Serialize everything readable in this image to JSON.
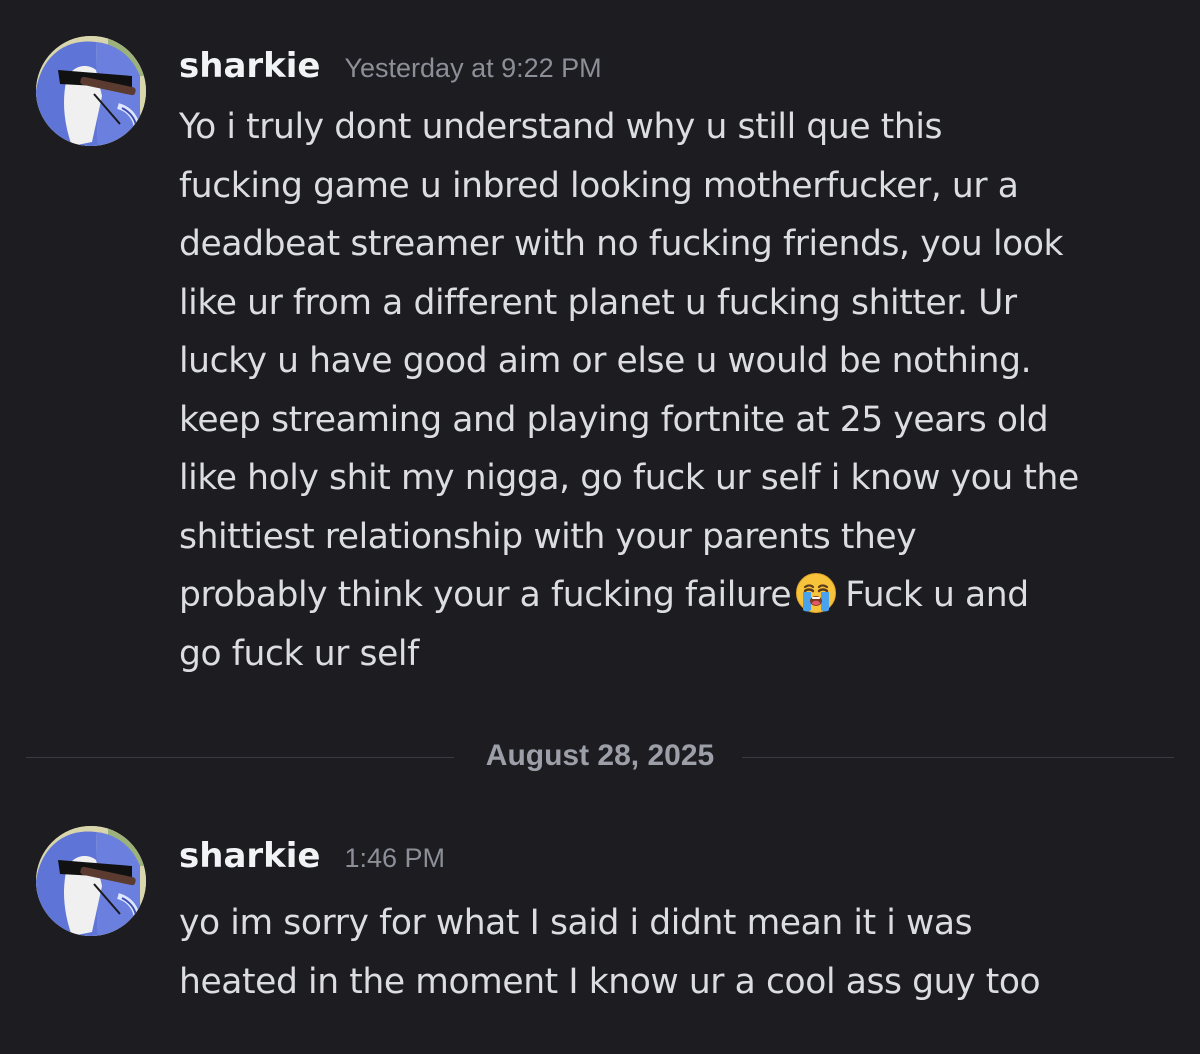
{
  "messages": [
    {
      "username": "sharkie",
      "timestamp": "Yesterday at 9:22 PM",
      "lines": [
        "Yo i truly dont understand why u still que this",
        "fucking game u inbred looking motherfucker, ur a",
        "deadbeat streamer with no fucking friends, you look",
        "like ur from a different planet u fucking shitter. Ur",
        "lucky u have good aim or else u would be nothing.",
        "keep streaming and playing fortnite at 25 years old",
        "like holy shit my nigga, go fuck ur self i know you the",
        "shittiest relationship with your parents they",
        "probably think your a fucking failure",
        "Fuck u and",
        "go fuck ur self"
      ],
      "emoji": "loudly-crying-face"
    },
    {
      "username": "sharkie",
      "timestamp": "1:46 PM",
      "lines": [
        "yo im sorry for what I said i didnt mean it i was",
        "heated in the moment I know ur a cool ass guy too"
      ]
    }
  ],
  "date_divider": "August 28, 2025",
  "colors": {
    "background": "#1c1c21",
    "username": "#f2f3f5",
    "message_text": "#dcdde1",
    "timestamp": "#8d8f98",
    "divider_text": "#9d9fa8",
    "divider_line": "#3a3b42"
  }
}
